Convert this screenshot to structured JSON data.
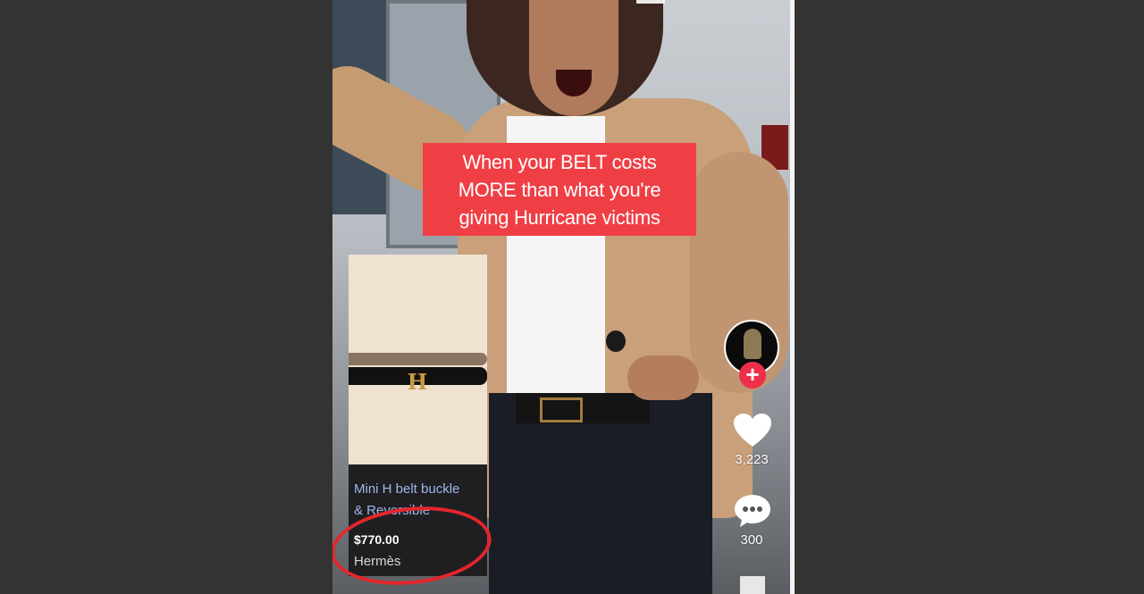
{
  "caption": {
    "lines": [
      "When your BELT costs",
      "MORE than what you're",
      "giving Hurricane victims"
    ]
  },
  "product_card": {
    "name_line1": "Mini H belt buckle",
    "name_line2": "& Reversible",
    "price": "$770.00",
    "brand": "Hermès",
    "buckle_letter": "H"
  },
  "actions": {
    "like_count": "3,223",
    "comment_count": "300",
    "follow_symbol": "+"
  },
  "icons": [
    "heart-icon",
    "comment-icon",
    "plus-icon"
  ],
  "colors": {
    "caption_bg": "#ef3f45",
    "highlight_circle": "#e4262b",
    "follow_badge": "#ec2f4b",
    "product_name_link": "#9fb8e8"
  }
}
